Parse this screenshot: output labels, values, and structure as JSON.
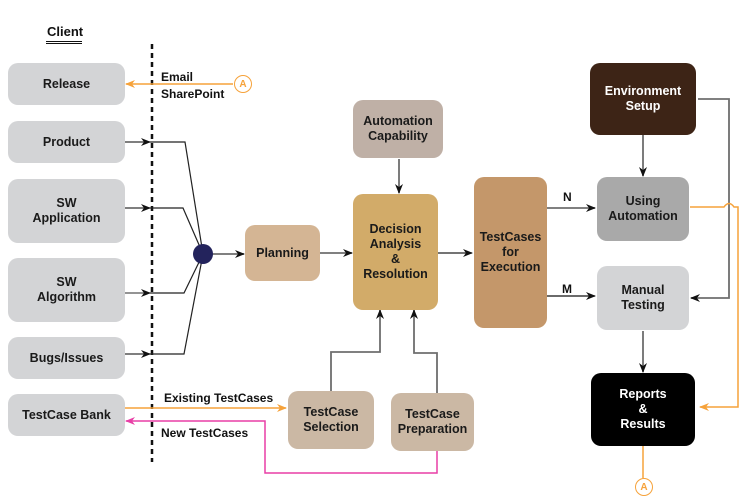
{
  "diagram": {
    "client_title": "Client",
    "client_nodes": [
      {
        "id": "release",
        "label": "Release"
      },
      {
        "id": "product",
        "label": "Product"
      },
      {
        "id": "sw-application",
        "label": "SW\nApplication"
      },
      {
        "id": "sw-algorithm",
        "label": "SW\nAlgorithm"
      },
      {
        "id": "bugs-issues",
        "label": "Bugs/Issues"
      },
      {
        "id": "testcase-bank",
        "label": "TestCase Bank"
      }
    ],
    "process_nodes": {
      "planning": "Planning",
      "automation_capability": "Automation\nCapability",
      "decision": "Decision\nAnalysis\n&\nResolution",
      "testcases_execution": "TestCases\nfor\nExecution",
      "environment_setup": "Environment\nSetup",
      "using_automation": "Using\nAutomation",
      "manual_testing": "Manual\nTesting",
      "reports_results": "Reports\n&\nResults",
      "testcase_selection": "TestCase\nSelection",
      "testcase_preparation": "TestCase\nPreparation"
    },
    "edge_labels": {
      "email": "Email",
      "sharepoint": "SharePoint",
      "existing_testcases": "Existing TestCases",
      "new_testcases": "New TestCases",
      "n": "N",
      "m": "M"
    },
    "connector_label": "A",
    "colors": {
      "client_box": "#d3d4d6",
      "planning": "#d4b594",
      "automation_capability": "#bfb0a6",
      "decision": "#d2ab69",
      "testcases_execution": "#c4976a",
      "environment_setup": "#3d2416",
      "using_automation": "#a9a9a9",
      "manual_testing": "#d3d4d6",
      "reports_results": "#000000",
      "testcase_boxes": "#cbb8a4",
      "hub": "#23235c",
      "orange_flow": "#f6a23a",
      "magenta_flow": "#e83fa6",
      "gray_line": "#6e6e6e"
    }
  }
}
